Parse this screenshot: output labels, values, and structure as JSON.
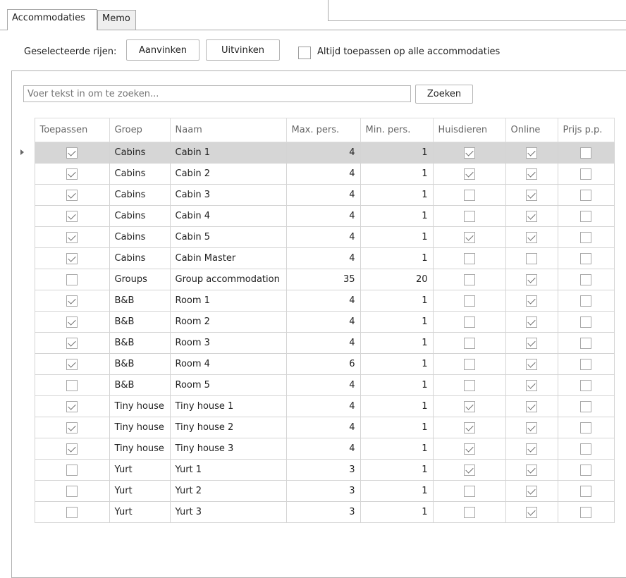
{
  "tabs": [
    {
      "label": "Accommodaties",
      "active": true
    },
    {
      "label": "Memo",
      "active": false
    }
  ],
  "toolbar": {
    "selected_rows_label": "Geselecteerde rijen:",
    "check_label": "Aanvinken",
    "uncheck_label": "Uitvinken",
    "apply_all_label": "Altijd toepassen op alle accommodaties",
    "apply_all_checked": false
  },
  "search": {
    "placeholder": "Voer tekst in om te zoeken...",
    "button_label": "Zoeken"
  },
  "grid": {
    "columns": [
      "Toepassen",
      "Groep",
      "Naam",
      "Max. pers.",
      "Min. pers.",
      "Huisdieren",
      "Online",
      "Prijs p.p."
    ],
    "selected_row": 0,
    "rows": [
      {
        "toepassen": true,
        "groep": "Cabins",
        "naam": "Cabin 1",
        "max": "4",
        "min": "1",
        "huisdieren": true,
        "online": true,
        "prijs": false
      },
      {
        "toepassen": true,
        "groep": "Cabins",
        "naam": "Cabin 2",
        "max": "4",
        "min": "1",
        "huisdieren": true,
        "online": true,
        "prijs": false
      },
      {
        "toepassen": true,
        "groep": "Cabins",
        "naam": "Cabin 3",
        "max": "4",
        "min": "1",
        "huisdieren": false,
        "online": true,
        "prijs": false
      },
      {
        "toepassen": true,
        "groep": "Cabins",
        "naam": "Cabin 4",
        "max": "4",
        "min": "1",
        "huisdieren": false,
        "online": true,
        "prijs": false
      },
      {
        "toepassen": true,
        "groep": "Cabins",
        "naam": "Cabin 5",
        "max": "4",
        "min": "1",
        "huisdieren": true,
        "online": true,
        "prijs": false
      },
      {
        "toepassen": true,
        "groep": "Cabins",
        "naam": "Cabin Master",
        "max": "4",
        "min": "1",
        "huisdieren": false,
        "online": false,
        "prijs": false
      },
      {
        "toepassen": false,
        "groep": "Groups",
        "naam": "Group accommodation",
        "max": "35",
        "min": "20",
        "huisdieren": false,
        "online": true,
        "prijs": false
      },
      {
        "toepassen": true,
        "groep": "B&B",
        "naam": "Room 1",
        "max": "4",
        "min": "1",
        "huisdieren": false,
        "online": true,
        "prijs": false
      },
      {
        "toepassen": true,
        "groep": "B&B",
        "naam": "Room 2",
        "max": "4",
        "min": "1",
        "huisdieren": false,
        "online": true,
        "prijs": false
      },
      {
        "toepassen": true,
        "groep": "B&B",
        "naam": "Room 3",
        "max": "4",
        "min": "1",
        "huisdieren": false,
        "online": true,
        "prijs": false
      },
      {
        "toepassen": true,
        "groep": "B&B",
        "naam": "Room 4",
        "max": "6",
        "min": "1",
        "huisdieren": false,
        "online": true,
        "prijs": false
      },
      {
        "toepassen": false,
        "groep": "B&B",
        "naam": "Room 5",
        "max": "4",
        "min": "1",
        "huisdieren": false,
        "online": true,
        "prijs": false
      },
      {
        "toepassen": true,
        "groep": "Tiny house",
        "naam": "Tiny house 1",
        "max": "4",
        "min": "1",
        "huisdieren": true,
        "online": true,
        "prijs": false
      },
      {
        "toepassen": true,
        "groep": "Tiny house",
        "naam": "Tiny house 2",
        "max": "4",
        "min": "1",
        "huisdieren": true,
        "online": true,
        "prijs": false
      },
      {
        "toepassen": true,
        "groep": "Tiny house",
        "naam": "Tiny house 3",
        "max": "4",
        "min": "1",
        "huisdieren": true,
        "online": true,
        "prijs": false
      },
      {
        "toepassen": false,
        "groep": "Yurt",
        "naam": "Yurt 1",
        "max": "3",
        "min": "1",
        "huisdieren": true,
        "online": true,
        "prijs": false
      },
      {
        "toepassen": false,
        "groep": "Yurt",
        "naam": "Yurt 2",
        "max": "3",
        "min": "1",
        "huisdieren": false,
        "online": true,
        "prijs": false
      },
      {
        "toepassen": false,
        "groep": "Yurt",
        "naam": "Yurt 3",
        "max": "3",
        "min": "1",
        "huisdieren": false,
        "online": true,
        "prijs": false
      }
    ]
  }
}
